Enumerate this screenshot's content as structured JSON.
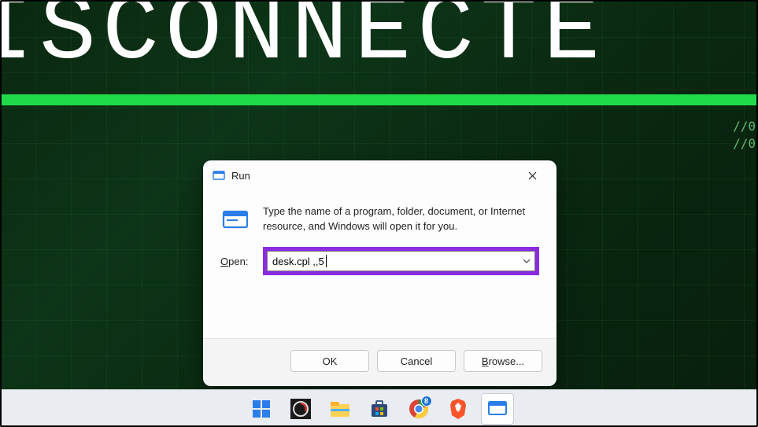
{
  "wallpaper": {
    "banner_text": "ISCONNECTE",
    "side_code_1": "//0",
    "side_code_2": "//0"
  },
  "run_dialog": {
    "title": "Run",
    "description": "Type the name of a program, folder, document, or Internet resource, and Windows will open it for you.",
    "open_label_pre": "O",
    "open_label_post": "pen:",
    "input_value": "desk.cpl ,,5",
    "buttons": {
      "ok": "OK",
      "cancel": "Cancel",
      "browse_pre": "B",
      "browse_post": "rowse..."
    }
  },
  "taskbar": {
    "chrome_badge": "8"
  }
}
